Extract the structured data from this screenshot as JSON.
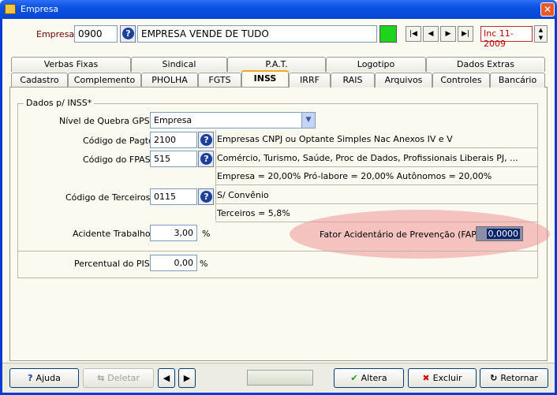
{
  "window": {
    "title": "Empresa"
  },
  "header": {
    "empresa_label": "Empresa",
    "empresa_code": "0900",
    "empresa_name": "EMPRESA VENDE DE TUDO",
    "nav": [
      "|◀",
      "◀",
      "▶",
      "▶|"
    ],
    "date_value": "Inc 11-2009",
    "status_color": "#1bd41b"
  },
  "tabs_row1": [
    "Verbas Fixas",
    "Sindical",
    "P.A.T.",
    "Logotipo",
    "Dados Extras"
  ],
  "tabs_row2": [
    "Cadastro",
    "Complemento",
    "PHOLHA",
    "FGTS",
    "INSS",
    "IRRF",
    "RAIS",
    "Arquivos",
    "Controles",
    "Bancário"
  ],
  "active_tab": "INSS",
  "form": {
    "group_title": "Dados p/ INSS*",
    "nivel_label": "Nível de Quebra GPS",
    "nivel_value": "Empresa",
    "pagto_label": "Código de Pagto",
    "pagto_value": "2100",
    "pagto_desc": "Empresas CNPJ ou Optante Simples Nac Anexos IV e V",
    "fpas_label": "Código do FPAS",
    "fpas_value": "515",
    "fpas_desc": "Comércio, Turismo, Saúde, Proc de Dados, Profissionais Liberais PJ, ...",
    "fpas_rates": "Empresa = 20,00% Pró-labore = 20,00% Autônomos = 20,00%",
    "terceiros_label": "Código de Terceiros",
    "terceiros_value": "0115",
    "terceiros_desc": "S/ Convênio",
    "terceiros_rate": "Terceiros = 5,8%",
    "acidente_label": "Acidente Trabalho",
    "acidente_value": "3,00",
    "pct": "%",
    "fap_label": "Fator Acidentário de Prevenção (FAP)",
    "fap_value": "0,0000",
    "pis_label": "Percentual do PIS",
    "pis_value": "0,00"
  },
  "footer": {
    "ajuda": "Ajuda",
    "deletar": "Deletar",
    "altera": "Altera",
    "excluir": "Excluir",
    "retornar": "Retornar"
  }
}
